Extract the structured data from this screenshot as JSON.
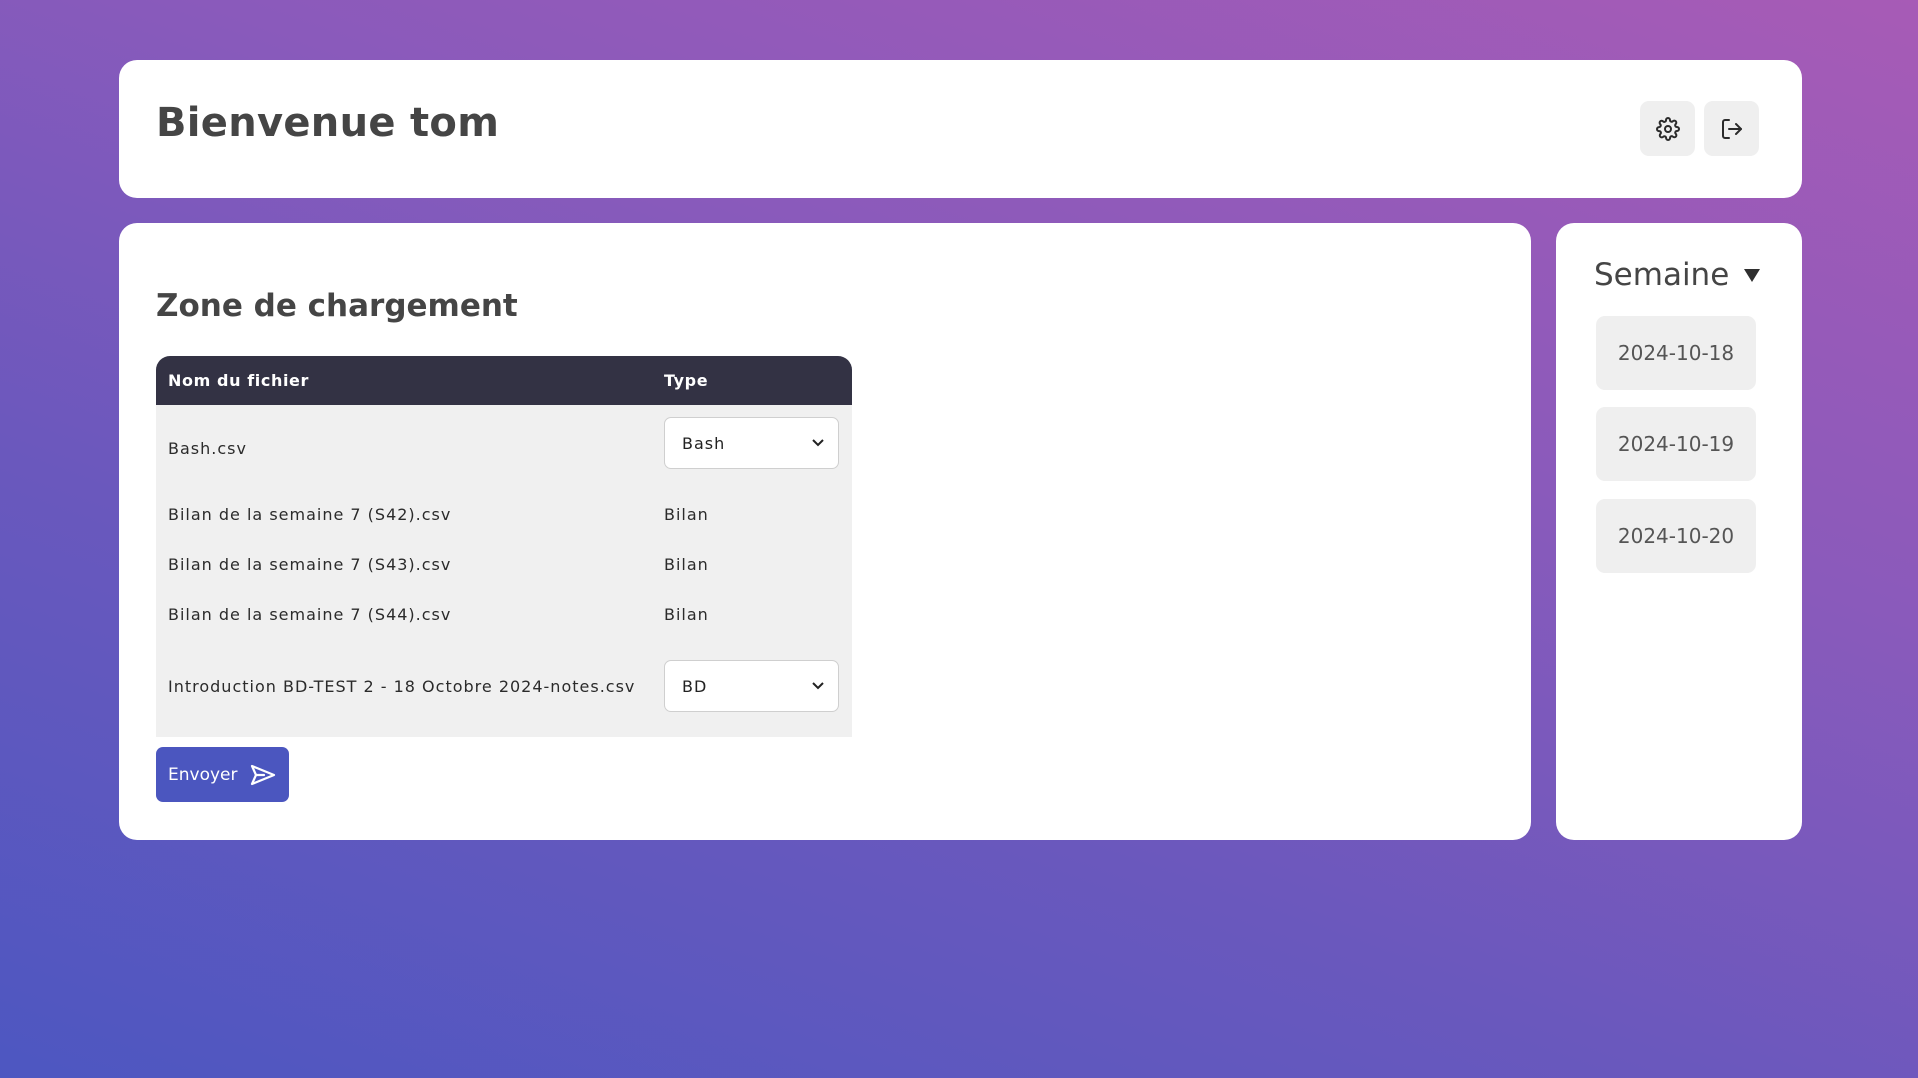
{
  "header": {
    "welcome": "Bienvenue tom",
    "settings_icon": "gear-icon",
    "logout_icon": "logout-icon"
  },
  "upload": {
    "title": "Zone de chargement",
    "columns": {
      "name": "Nom du fichier",
      "type": "Type"
    },
    "rows": [
      {
        "name": "Bash.csv",
        "type": "Bash",
        "control": "select"
      },
      {
        "name": "Bilan de la semaine 7 (S42).csv",
        "type": "Bilan",
        "control": "text"
      },
      {
        "name": "Bilan de la semaine 7 (S43).csv",
        "type": "Bilan",
        "control": "text"
      },
      {
        "name": "Bilan de la semaine 7 (S44).csv",
        "type": "Bilan",
        "control": "text"
      },
      {
        "name": "Introduction BD-TEST 2 - 18 Octobre 2024-notes.csv",
        "type": "BD",
        "control": "select"
      }
    ],
    "send_label": "Envoyer",
    "send_icon": "send-icon"
  },
  "week": {
    "title": "Semaine",
    "dates": [
      "2024-10-18",
      "2024-10-19",
      "2024-10-20"
    ]
  },
  "colors": {
    "primary": "#4b56bf",
    "table_header": "#333244",
    "gradient_start": "#4d57c1",
    "gradient_end": "#a75bb6"
  }
}
